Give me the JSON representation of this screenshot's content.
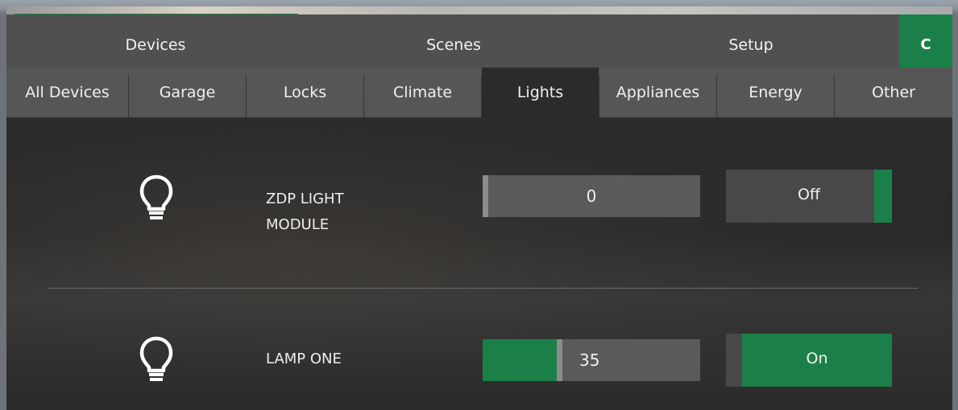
{
  "colors": {
    "accent": "#1a8048",
    "tab_bg": "#505050",
    "subtab_bg": "#565656",
    "active_bg": "#2b2b2b"
  },
  "progress": {
    "fraction": 0.3
  },
  "main_tabs": [
    {
      "label": "Devices"
    },
    {
      "label": "Scenes"
    },
    {
      "label": "Setup"
    }
  ],
  "refresh": {
    "icon": "refresh-icon",
    "glyph": "C"
  },
  "sub_tabs": [
    {
      "label": "All Devices",
      "active": false
    },
    {
      "label": "Garage",
      "active": false
    },
    {
      "label": "Locks",
      "active": false
    },
    {
      "label": "Climate",
      "active": false
    },
    {
      "label": "Lights",
      "active": true
    },
    {
      "label": "Appliances",
      "active": false
    },
    {
      "label": "Energy",
      "active": false
    },
    {
      "label": "Other",
      "active": false
    }
  ],
  "devices": [
    {
      "icon": "lightbulb-icon",
      "name_lines": [
        "ZDP LIGHT",
        "MODULE"
      ],
      "level": "0",
      "level_fraction": 0.0,
      "state": "Off",
      "on": false
    },
    {
      "icon": "lightbulb-icon",
      "name_lines": [
        "LAMP ONE"
      ],
      "level": "35",
      "level_fraction": 0.35,
      "state": "On",
      "on": true
    }
  ]
}
